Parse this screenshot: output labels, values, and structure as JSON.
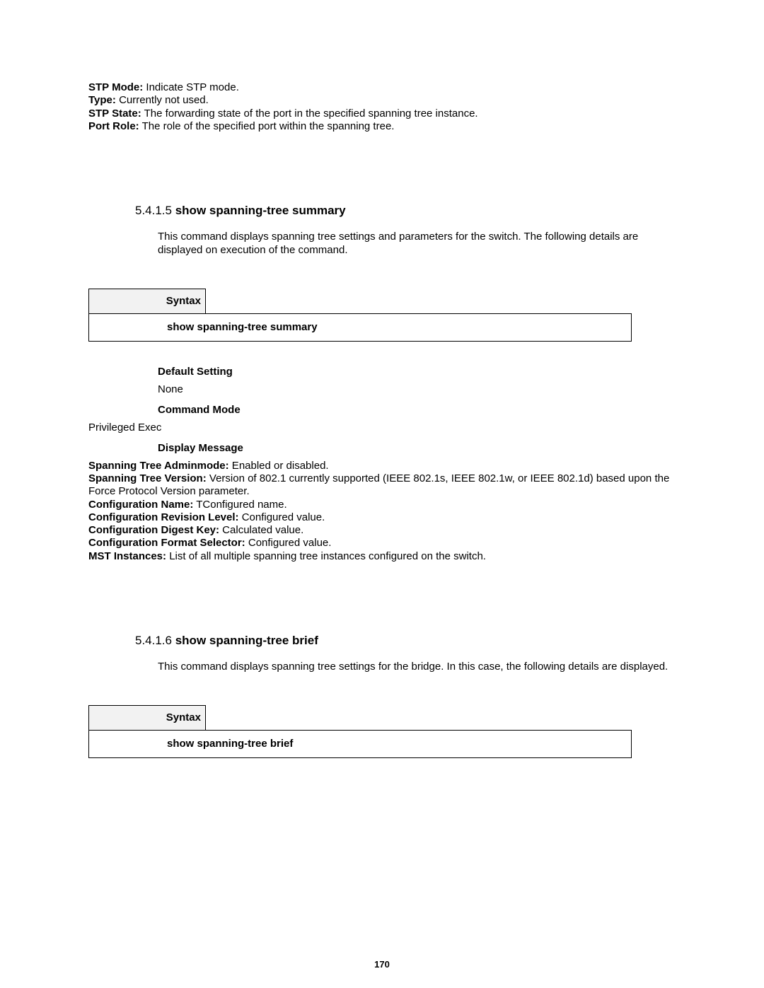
{
  "top_defs": [
    {
      "label": "STP Mode:",
      "value": " Indicate STP mode."
    },
    {
      "label": "Type:",
      "value": " Currently not used."
    },
    {
      "label": "STP State:",
      "value": " The forwarding state of the port in the specified spanning tree instance."
    },
    {
      "label": "Port Role:",
      "value": " The role of the specified port within the spanning tree."
    }
  ],
  "section1": {
    "number": "5.4.1.5 ",
    "title": "show spanning-tree summary",
    "body": "This command displays spanning tree settings and parameters for the switch. The following details are displayed on execution of the command.",
    "syntax_label": "Syntax",
    "syntax_cmd": "show spanning-tree summary",
    "default_setting_h": "Default Setting",
    "default_setting_v": "None",
    "command_mode_h": "Command Mode",
    "command_mode_v": "Privileged Exec",
    "display_message_h": "Display Message",
    "messages": [
      {
        "label": "Spanning Tree Adminmode:",
        "value": " Enabled or disabled."
      },
      {
        "label": "Spanning Tree Version:",
        "value": " Version of 802.1 currently supported (IEEE 802.1s, IEEE 802.1w, or IEEE 802.1d) based upon the Force Protocol Version parameter."
      },
      {
        "label": "Configuration Name:",
        "value": " TConfigured name."
      },
      {
        "label": "Configuration Revision Level:",
        "value": " Configured value."
      },
      {
        "label": "Configuration Digest Key:",
        "value": " Calculated value."
      },
      {
        "label": "Configuration Format Selector:",
        "value": " Configured value."
      },
      {
        "label": "MST Instances:",
        "value": " List of all multiple spanning tree instances configured on the switch."
      }
    ]
  },
  "section2": {
    "number": "5.4.1.6 ",
    "title": "show spanning-tree brief",
    "body": "This command displays spanning tree settings for the bridge. In this case, the following details are displayed.",
    "syntax_label": "Syntax",
    "syntax_cmd": "show spanning-tree brief"
  },
  "page_number": "170"
}
